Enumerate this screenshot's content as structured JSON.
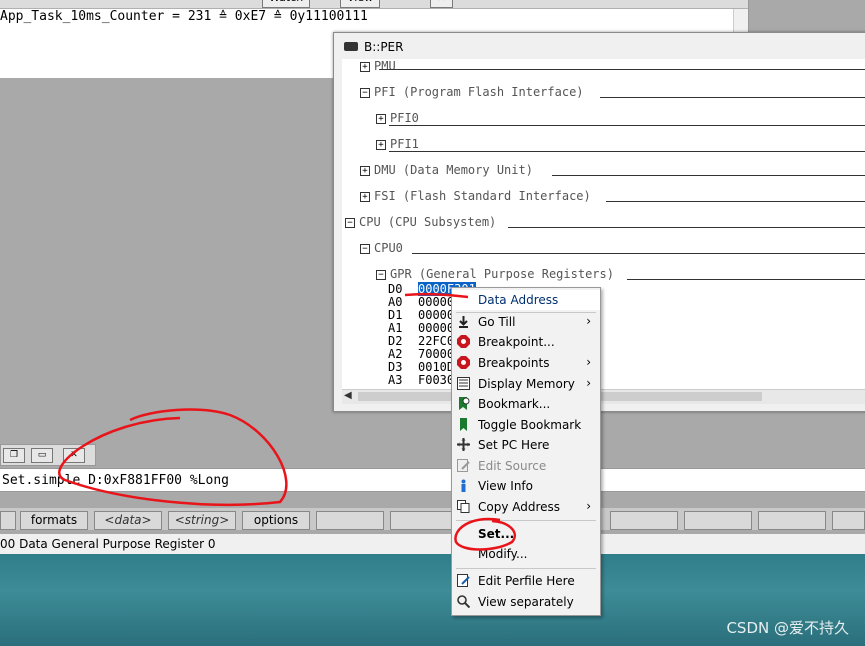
{
  "var_window": {
    "toolbar": {
      "watch_label": "Watch",
      "view_label": "View"
    },
    "expression_line": "App_Task_10ms_Counter = 231 ≙ 0xE7 ≙ 0y11100111"
  },
  "per_window": {
    "title": "B::PER",
    "tree": [
      {
        "label": "PMU",
        "toggle": "⊞"
      },
      {
        "label": "PFI (Program Flash Interface)",
        "toggle": "⊟"
      },
      {
        "label": "PFI0",
        "toggle": "⊞"
      },
      {
        "label": "PFI1",
        "toggle": "⊞"
      },
      {
        "label": "DMU (Data Memory Unit)",
        "toggle": "⊞"
      },
      {
        "label": "FSI (Flash Standard Interface)",
        "toggle": "⊞"
      },
      {
        "label": "CPU (CPU Subsystem)",
        "toggle": "⊟"
      },
      {
        "label": "CPU0",
        "toggle": "⊟"
      },
      {
        "label": "GPR (General Purpose Registers)",
        "toggle": "⊟"
      }
    ],
    "registers": [
      {
        "name": "D0",
        "value": "0000F301"
      },
      {
        "name": "A0",
        "value": "00000"
      },
      {
        "name": "D1",
        "value": "00000"
      },
      {
        "name": "A1",
        "value": "00000"
      },
      {
        "name": "D2",
        "value": "22FC0"
      },
      {
        "name": "A2",
        "value": "70000"
      },
      {
        "name": "D3",
        "value": "0010D"
      },
      {
        "name": "A3",
        "value": "F0030"
      }
    ]
  },
  "command_line": {
    "text": "Set.simple D:0xF881FF00 %Long",
    "window_controls": [
      "restore",
      "minimize",
      "close"
    ]
  },
  "soft_keys": [
    "formats",
    "<data>",
    "<string>",
    "options"
  ],
  "status_bar": "00 Data General Purpose Register 0",
  "context_menu": {
    "items": [
      {
        "label": "Data Address",
        "icon": "none",
        "submenu": false,
        "enabled": true,
        "highlighted": true
      },
      {
        "label": "Go Till",
        "icon": "go-till-icon",
        "submenu": true,
        "enabled": true
      },
      {
        "label": "Breakpoint...",
        "icon": "breakpoint-icon",
        "submenu": false,
        "enabled": true
      },
      {
        "label": "Breakpoints",
        "icon": "breakpoints-icon",
        "submenu": true,
        "enabled": true
      },
      {
        "label": "Display Memory",
        "icon": "memory-icon",
        "submenu": true,
        "enabled": true
      },
      {
        "label": "Bookmark...",
        "icon": "bookmark-icon",
        "submenu": false,
        "enabled": true
      },
      {
        "label": "Toggle Bookmark",
        "icon": "toggle-bookmark-icon",
        "submenu": false,
        "enabled": true
      },
      {
        "label": "Set PC Here",
        "icon": "set-pc-icon",
        "submenu": false,
        "enabled": true
      },
      {
        "label": "Edit Source",
        "icon": "edit-source-icon",
        "submenu": false,
        "enabled": false
      },
      {
        "label": "View Info",
        "icon": "info-icon",
        "submenu": false,
        "enabled": true
      },
      {
        "label": "Copy Address",
        "icon": "copy-icon",
        "submenu": true,
        "enabled": true
      },
      {
        "label": "Set...",
        "icon": "none",
        "submenu": false,
        "enabled": true,
        "bold": true
      },
      {
        "label": "Modify...",
        "icon": "none",
        "submenu": false,
        "enabled": true
      },
      {
        "label": "Edit Perfile Here",
        "icon": "edit-perfile-icon",
        "submenu": false,
        "enabled": true
      },
      {
        "label": "View separately",
        "icon": "search-icon",
        "submenu": false,
        "enabled": true
      }
    ],
    "submenu_arrow": "›"
  },
  "watermark": "CSDN @爱不持久",
  "colors": {
    "annotation": "#e8141a",
    "desktop": "#3d8c97",
    "selection": "#0a64c8"
  }
}
